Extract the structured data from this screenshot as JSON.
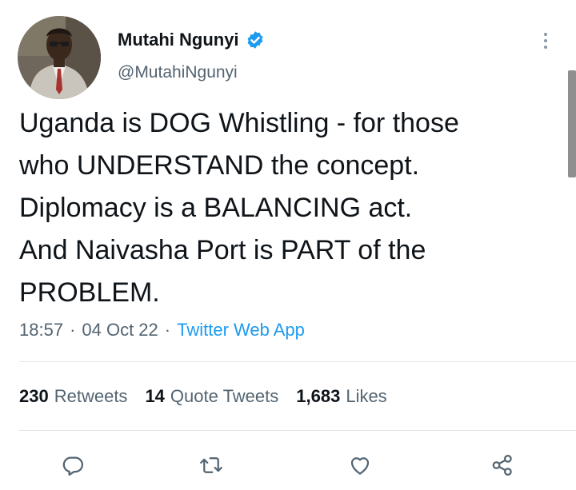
{
  "user": {
    "display_name": "Mutahi Ngunyi",
    "handle": "@MutahiNgunyi",
    "verified_badge_color": "#1d9bf0"
  },
  "tweet": {
    "text_lines": [
      "Uganda is DOG Whistling - for those",
      "who UNDERSTAND the concept.",
      "Diplomacy is a BALANCING act.",
      "And Naivasha Port is PART of the",
      "PROBLEM."
    ],
    "time": "18:57",
    "separator": "·",
    "date": "04 Oct 22",
    "source": "Twitter Web App"
  },
  "stats": {
    "retweets_count": "230",
    "retweets_label": "Retweets",
    "quotes_count": "14",
    "quotes_label": "Quote Tweets",
    "likes_count": "1,683",
    "likes_label": "Likes"
  },
  "icons": {
    "avatar": "avatar-photo",
    "verified": "verified-badge-icon",
    "more": "more-options-icon",
    "reply": "reply-icon",
    "retweet": "retweet-icon",
    "like": "like-icon",
    "share": "share-icon"
  },
  "colors": {
    "accent": "#1d9bf0",
    "text": "#0f1419",
    "secondary": "#536471"
  }
}
